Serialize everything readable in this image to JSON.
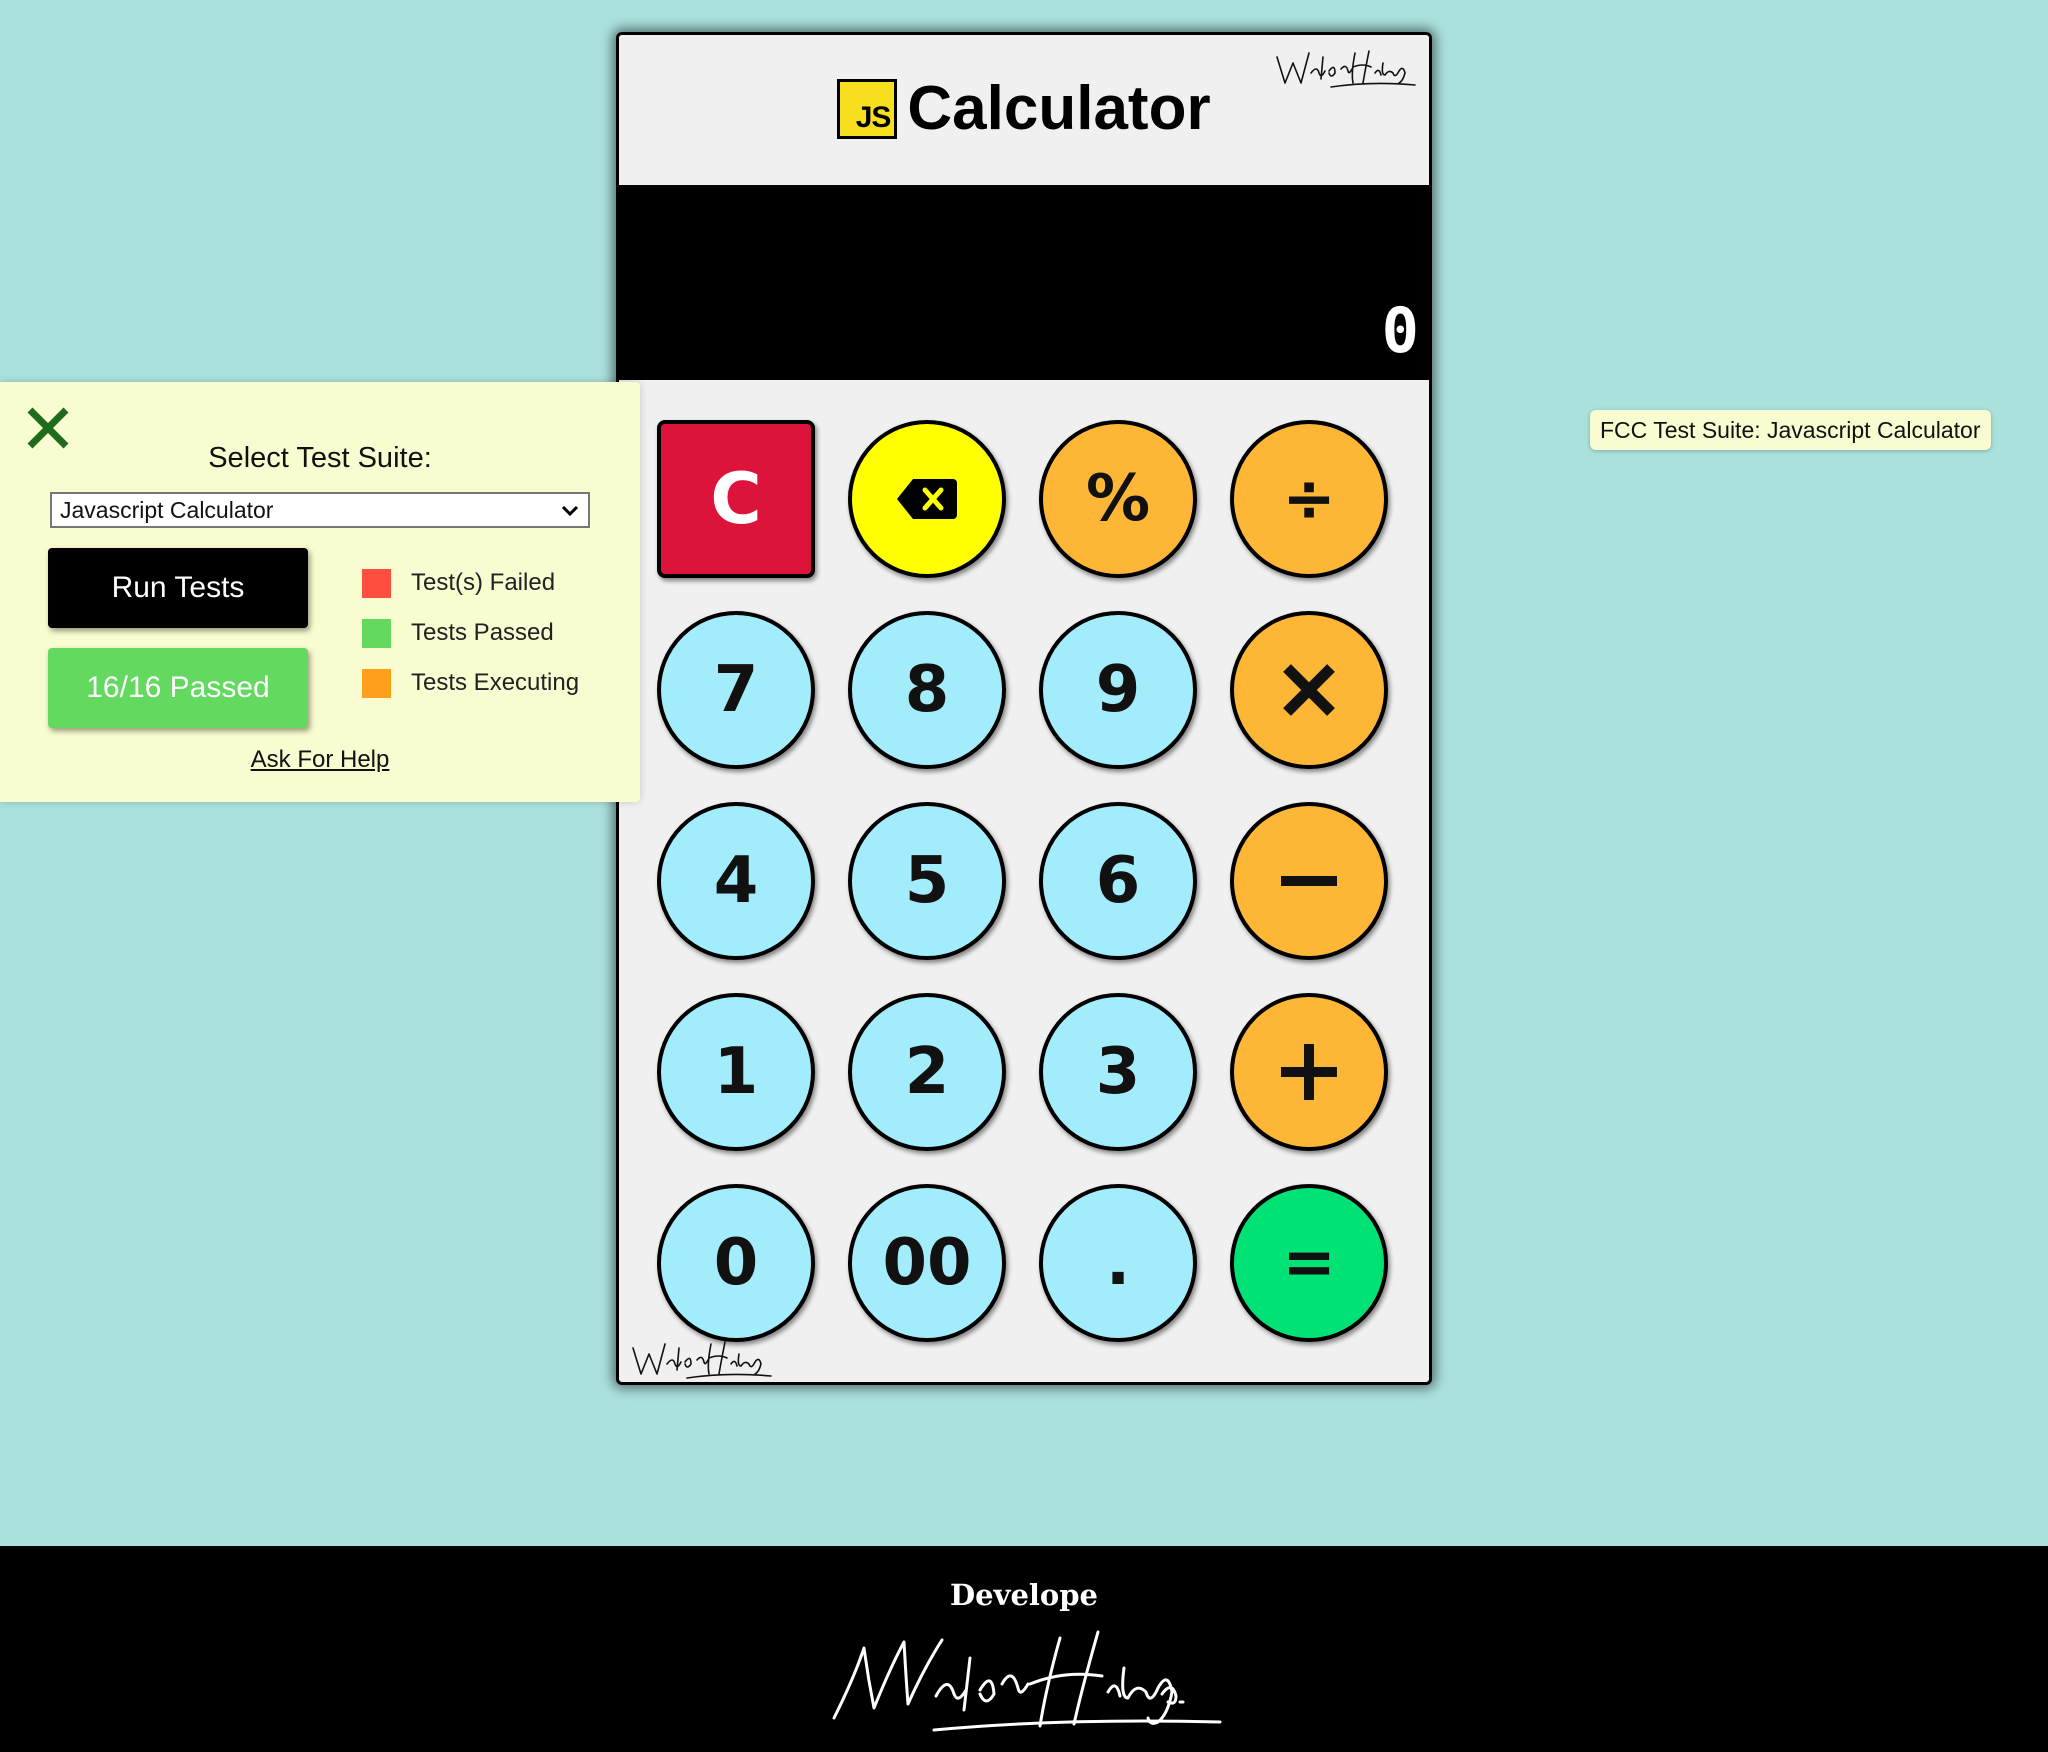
{
  "calculator": {
    "logo_text": "JS",
    "title": "Calculator",
    "signature": "Waldo Hidalgo",
    "display": {
      "formula": "",
      "value": "0"
    },
    "keys": [
      {
        "id": "clear",
        "label": "C",
        "kind": "clear"
      },
      {
        "id": "delete",
        "label": "",
        "kind": "del",
        "icon": "backspace-icon"
      },
      {
        "id": "percent",
        "label": "%",
        "kind": "op"
      },
      {
        "id": "divide",
        "label": "÷",
        "kind": "op"
      },
      {
        "id": "seven",
        "label": "7",
        "kind": "num"
      },
      {
        "id": "eight",
        "label": "8",
        "kind": "num"
      },
      {
        "id": "nine",
        "label": "9",
        "kind": "num"
      },
      {
        "id": "multiply",
        "label": "",
        "kind": "op",
        "icon": "multiply-icon"
      },
      {
        "id": "four",
        "label": "4",
        "kind": "num"
      },
      {
        "id": "five",
        "label": "5",
        "kind": "num"
      },
      {
        "id": "six",
        "label": "6",
        "kind": "num"
      },
      {
        "id": "subtract",
        "label": "",
        "kind": "op",
        "icon": "minus-icon"
      },
      {
        "id": "one",
        "label": "1",
        "kind": "num"
      },
      {
        "id": "two",
        "label": "2",
        "kind": "num"
      },
      {
        "id": "three",
        "label": "3",
        "kind": "num"
      },
      {
        "id": "add",
        "label": "",
        "kind": "op",
        "icon": "plus-icon"
      },
      {
        "id": "zero",
        "label": "0",
        "kind": "num"
      },
      {
        "id": "double-zero",
        "label": "00",
        "kind": "num"
      },
      {
        "id": "decimal",
        "label": ".",
        "kind": "num"
      },
      {
        "id": "equals",
        "label": "=",
        "kind": "eq"
      }
    ]
  },
  "fcc_panel": {
    "select_label": "Select Test Suite:",
    "selected_suite": "Javascript Calculator",
    "run_button": "Run Tests",
    "result": "16/16 Passed",
    "legend": [
      {
        "label": "Test(s) Failed",
        "color": "#ff4e3f"
      },
      {
        "label": "Tests Passed",
        "color": "#64d960"
      },
      {
        "label": "Tests Executing",
        "color": "#ff9f1a"
      }
    ],
    "help_link": "Ask For Help"
  },
  "fcc_tag": "FCC Test Suite: Javascript Calculator",
  "footer": {
    "label": "Develope",
    "signature": "Waldo Hidalgo"
  },
  "colors": {
    "background": "#abe1dd",
    "number_key": "#a3ecfb",
    "operator_key": "#fdb635",
    "delete_key": "#ffff00",
    "equals_key": "#00e275",
    "clear_key": "#dc143c",
    "js_logo": "#f7df1e",
    "panel": "#f9fcd0",
    "close_icon": "#1e6b1e"
  }
}
